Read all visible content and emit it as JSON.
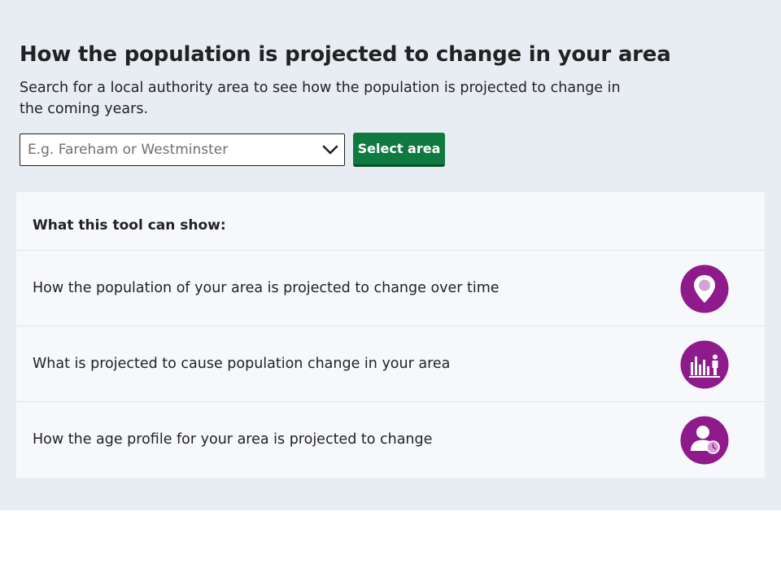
{
  "header": {
    "title": "How the population is projected to change in your area",
    "intro": "Search for a local authority area to see how the population is projected to change in the coming years."
  },
  "search": {
    "placeholder": "E.g. Fareham or Westminster",
    "button_label": "Select area"
  },
  "features": {
    "heading": "What this tool can show:",
    "items": [
      {
        "label": "How the population of your area is projected to change over time",
        "icon": "location-pin-icon"
      },
      {
        "label": "What is projected to cause population change in your area",
        "icon": "bar-chart-person-icon"
      },
      {
        "label": "How the age profile for your area is projected to change",
        "icon": "person-clock-icon"
      }
    ]
  },
  "colors": {
    "panel_background": "#e8edf3",
    "button_green": "#0f7a3f",
    "icon_purple": "#8f1a8c"
  }
}
